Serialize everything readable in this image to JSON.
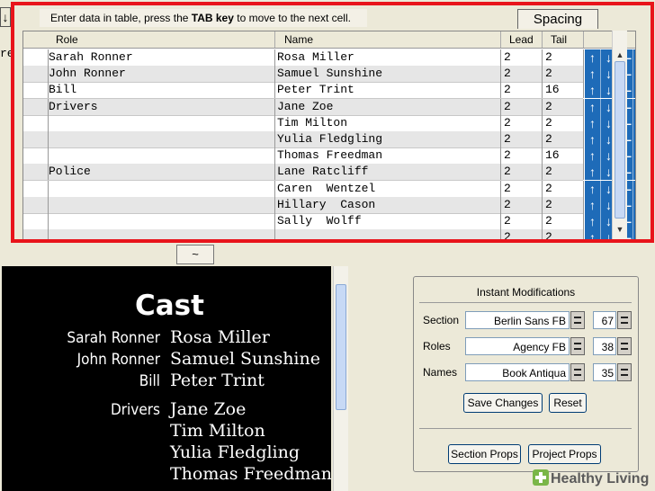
{
  "toolbar": {
    "arrow_glyph": "↓",
    "clipped_text": "re"
  },
  "instruction": {
    "prefix": "Enter data in table, press the ",
    "key": "TAB key",
    "suffix": " to move to the next cell."
  },
  "spacing_tab": "Spacing",
  "table": {
    "columns": [
      "Role",
      "Name",
      "Lead",
      "Tail"
    ],
    "rows": [
      {
        "role": "Sarah Ronner",
        "name": "Rosa Miller",
        "lead": "2",
        "tail": "2"
      },
      {
        "role": "John Ronner",
        "name": "Samuel Sunshine",
        "lead": "2",
        "tail": "2"
      },
      {
        "role": "Bill",
        "name": "Peter Trint",
        "lead": "2",
        "tail": "16"
      },
      {
        "role": "Drivers",
        "name": "Jane Zoe",
        "lead": "2",
        "tail": "2"
      },
      {
        "role": "",
        "name": "Tim Milton",
        "lead": "2",
        "tail": "2"
      },
      {
        "role": "",
        "name": "Yulia Fledgling",
        "lead": "2",
        "tail": "2"
      },
      {
        "role": "",
        "name": "Thomas Freedman",
        "lead": "2",
        "tail": "16"
      },
      {
        "role": "Police",
        "name": "Lane Ratcliff",
        "lead": "2",
        "tail": "2"
      },
      {
        "role": "",
        "name": "Caren  Wentzel",
        "lead": "2",
        "tail": "2"
      },
      {
        "role": "",
        "name": "Hillary  Cason",
        "lead": "2",
        "tail": "2"
      },
      {
        "role": "",
        "name": "Sally  Wolff",
        "lead": "2",
        "tail": "2"
      },
      {
        "role": "",
        "name": "",
        "lead": "2",
        "tail": "2"
      }
    ],
    "row_buttons": {
      "up": "↑",
      "down": "↓",
      "remove": "—"
    }
  },
  "tilde_button": "~",
  "preview": {
    "title": "Cast",
    "entries": [
      {
        "role": "Sarah Ronner",
        "name": "Rosa Miller"
      },
      {
        "role": "John Ronner",
        "name": "Samuel Sunshine"
      },
      {
        "role": "Bill",
        "name": "Peter Trint"
      },
      {
        "role": "Drivers",
        "name": "Jane Zoe"
      },
      {
        "role": "",
        "name": "Tim Milton"
      },
      {
        "role": "",
        "name": "Yulia Fledgling"
      },
      {
        "role": "",
        "name": "Thomas Freedman"
      }
    ]
  },
  "panel": {
    "title": "Instant Modifications",
    "section": {
      "label": "Section",
      "font": "Berlin Sans FB",
      "size": "67"
    },
    "roles": {
      "label": "Roles",
      "font": "Agency FB",
      "size": "38"
    },
    "names": {
      "label": "Names",
      "font": "Book Antiqua",
      "size": "35"
    },
    "save_label": "Save Changes",
    "reset_label": "Reset",
    "section_props_label": "Section Props",
    "project_props_label": "Project Props"
  },
  "watermark": "Healthy Living",
  "colors": {
    "highlight": "#e8141b",
    "row_buttons": "#1e6bb8",
    "preview_bg": "#000000"
  }
}
